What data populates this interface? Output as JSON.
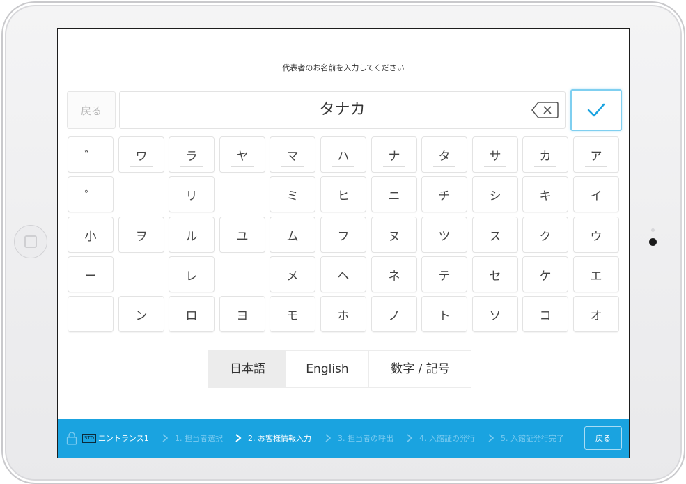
{
  "screen": {
    "prompt": "代表者のお名前を入力してください",
    "back_key_label": "戻る",
    "name_value": "タナカ"
  },
  "keyboard": {
    "rows": [
      [
        "゛",
        "ワ",
        "ラ",
        "ヤ",
        "マ",
        "ハ",
        "ナ",
        "タ",
        "サ",
        "カ",
        "ア"
      ],
      [
        "゜",
        "",
        "リ",
        "",
        "ミ",
        "ヒ",
        "ニ",
        "チ",
        "シ",
        "キ",
        "イ"
      ],
      [
        "小",
        "ヲ",
        "ル",
        "ユ",
        "ム",
        "フ",
        "ヌ",
        "ツ",
        "ス",
        "ク",
        "ウ"
      ],
      [
        "ー",
        "",
        "レ",
        "",
        "メ",
        "ヘ",
        "ネ",
        "テ",
        "セ",
        "ケ",
        "エ"
      ],
      [
        "",
        "ン",
        "ロ",
        "ヨ",
        "モ",
        "ホ",
        "ノ",
        "ト",
        "ソ",
        "コ",
        "オ"
      ]
    ]
  },
  "language_tabs": [
    {
      "label": "日本語",
      "active": true
    },
    {
      "label": "English",
      "active": false
    },
    {
      "label": "数字 / 記号",
      "active": false
    }
  ],
  "footer": {
    "location_badge": "STD",
    "location": "エントランス1",
    "steps": [
      {
        "label": "1. 担当者選択",
        "current": false
      },
      {
        "label": "2. お客様情報入力",
        "current": true
      },
      {
        "label": "3. 担当者の呼出",
        "current": false
      },
      {
        "label": "4. 入館証の発行",
        "current": false
      },
      {
        "label": "5. 入館証発行完了",
        "current": false
      }
    ],
    "back_label": "戻る"
  },
  "colors": {
    "footer_bg": "#1aa3e0",
    "confirm_accent": "#1aa3e0"
  }
}
